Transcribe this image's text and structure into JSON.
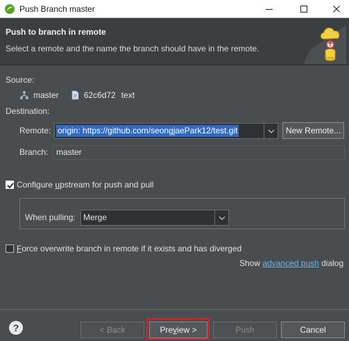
{
  "window": {
    "title": "Push Branch master"
  },
  "header": {
    "title": "Push to branch in remote",
    "description": "Select a remote and the name the branch should have in the remote."
  },
  "source": {
    "label": "Source:",
    "branch": "master",
    "commit_id": "62c6d72",
    "commit_message": "text"
  },
  "destination": {
    "label": "Destination:",
    "remote_label": "Remote:",
    "remote_value": "origin: https://github.com/seongjaePark12/test.git",
    "new_remote_button": "New Remote...",
    "branch_label": "Branch:",
    "branch_value": "master"
  },
  "upstream": {
    "checked": true,
    "label_pre": "Configure ",
    "label_mnemonic": "u",
    "label_post": "pstream for push and pull",
    "when_pulling_label": "When pulling:",
    "when_pulling_value": "Merge"
  },
  "force": {
    "checked": false,
    "label_mnemonic": "F",
    "label_post": "orce overwrite branch in remote if it exists and has diverged"
  },
  "advanced": {
    "pre": "Show",
    "link": "advanced push",
    "post": "dialog"
  },
  "footer": {
    "help": "?",
    "back": "< Back",
    "preview_pre": "Pre",
    "preview_mnemonic": "v",
    "preview_post": "iew >",
    "push": "Push",
    "cancel": "Cancel"
  },
  "colors": {
    "accent_selection": "#2f6ac6",
    "link": "#6fb3e8",
    "highlight_box": "#e02020"
  }
}
